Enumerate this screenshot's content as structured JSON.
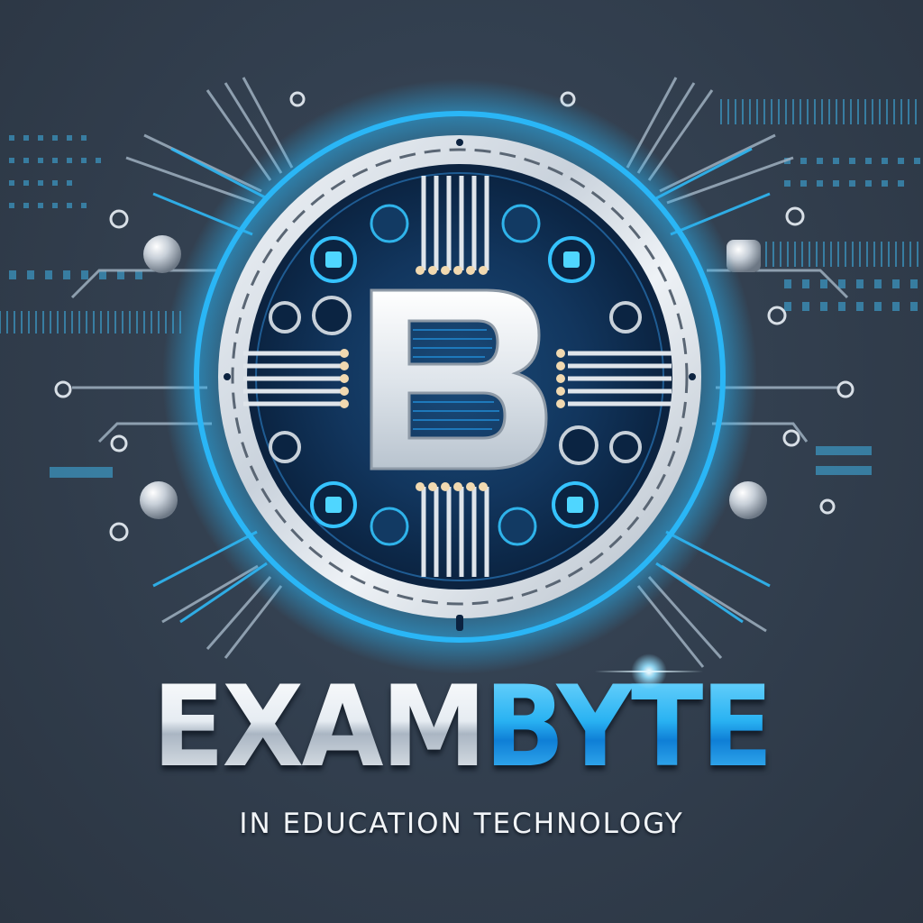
{
  "logo": {
    "emblem_letter": "B",
    "wordmark_part1": "EXAM",
    "wordmark_part2": "BYTE",
    "tagline": "IN EDUCATION TECHNOLOGY"
  },
  "colors": {
    "background": "#333e4c",
    "accent_blue": "#29b2f2",
    "silver": "#dfe5eb",
    "navy_circuit": "#0f2c4d"
  },
  "icons": [
    "circuit-trace-icon",
    "chip-node-icon",
    "silver-sphere-icon",
    "ring-node-icon",
    "lens-flare-icon"
  ]
}
